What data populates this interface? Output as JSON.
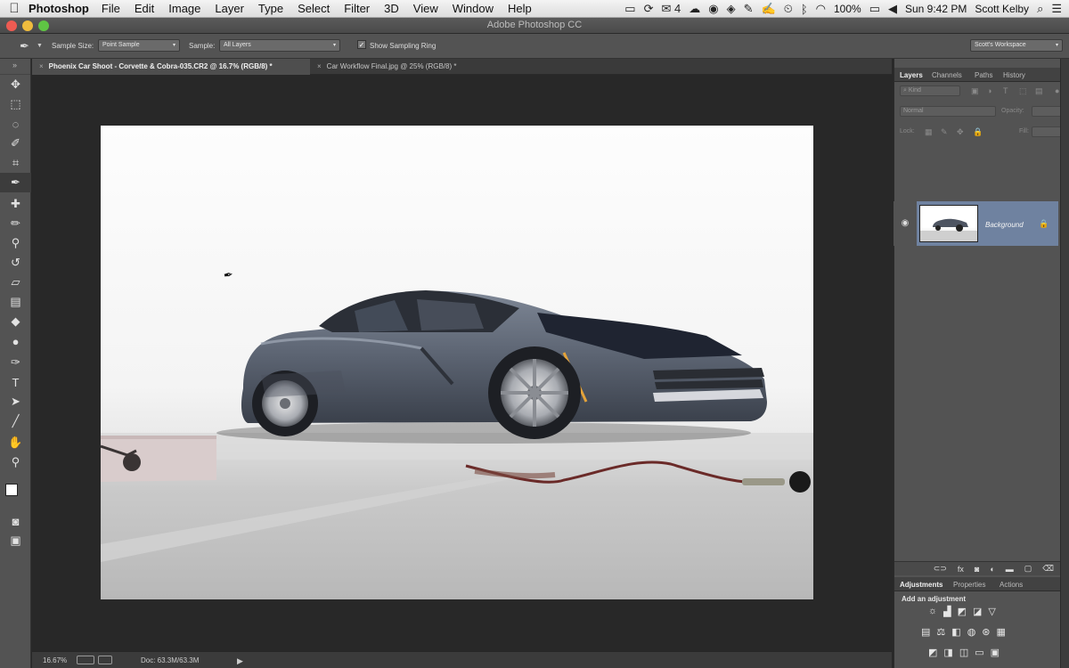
{
  "menubar": {
    "apple": "",
    "app_name": "Photoshop",
    "items": [
      "File",
      "Edit",
      "Image",
      "Layer",
      "Type",
      "Select",
      "Filter",
      "3D",
      "View",
      "Window",
      "Help"
    ],
    "status": {
      "badge": "4",
      "battery": "100%",
      "time": "Sun 9:42 PM",
      "user": "Scott Kelby"
    }
  },
  "window": {
    "title": "Adobe Photoshop CC",
    "traffic_lights": [
      "#ee5b52",
      "#f0bc3d",
      "#5fc444"
    ]
  },
  "options_bar": {
    "tool_icon": "eyedropper-icon",
    "sample_size_label": "Sample Size:",
    "sample_size_value": "Point Sample",
    "sample_label": "Sample:",
    "sample_value": "All Layers",
    "show_ring_label": "Show Sampling Ring",
    "show_ring_checked": true,
    "workspace": "Scott's Workspace"
  },
  "tabs": [
    {
      "label": "Phoenix Car Shoot - Corvette & Cobra-035.CR2 @ 16.7% (RGB/8) *",
      "active": true
    },
    {
      "label": "Car Workflow Final.jpg @ 25% (RGB/8) *",
      "active": false
    }
  ],
  "tools": [
    "move-tool-icon",
    "marquee-tool-icon",
    "lasso-tool-icon",
    "quick-select-tool-icon",
    "crop-tool-icon",
    "eyedropper-tool-icon",
    "healing-brush-tool-icon",
    "brush-tool-icon",
    "clone-stamp-tool-icon",
    "history-brush-tool-icon",
    "eraser-tool-icon",
    "gradient-tool-icon",
    "blur-tool-icon",
    "dodge-tool-icon",
    "pen-tool-icon",
    "type-tool-icon",
    "path-selection-tool-icon",
    "line-tool-icon",
    "hand-tool-icon",
    "zoom-tool-icon"
  ],
  "status_bar": {
    "zoom": "16.67%",
    "doc": "Doc: 63.3M/63.3M"
  },
  "layers_panel": {
    "tabs": [
      "Layers",
      "Channels",
      "Paths",
      "History"
    ],
    "active_tab": "Layers",
    "filter": "Kind",
    "blend_mode": "Normal",
    "opacity_label": "Opacity:",
    "lock_label": "Lock:",
    "fill_label": "Fill:",
    "layers": [
      {
        "name": "Background",
        "visible": true,
        "locked": true
      }
    ]
  },
  "adjustments_panel": {
    "tabs": [
      "Adjustments",
      "Properties",
      "Actions"
    ],
    "active_tab": "Adjustments",
    "title": "Add an adjustment"
  },
  "colors": {
    "selected_layer": "#6f82a0",
    "ui_dark": "#535353",
    "canvas_bg": "#282828"
  }
}
